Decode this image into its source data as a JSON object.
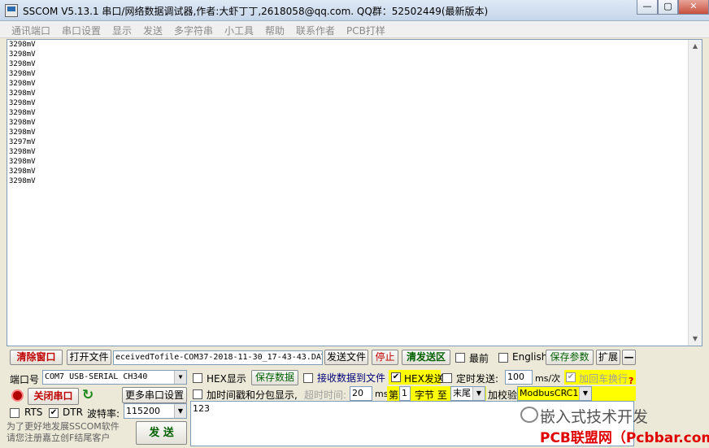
{
  "window": {
    "title": "SSCOM V5.13.1 串口/网络数据调试器,作者:大虾丁丁,2618058@qq.com. QQ群：52502449(最新版本)",
    "minimize_glyph": "—",
    "restore_glyph": "▢",
    "close_glyph": "✕"
  },
  "menu": [
    "通讯端口",
    "串口设置",
    "显示",
    "发送",
    "多字符串",
    "小工具",
    "帮助",
    "联系作者",
    "PCB打样"
  ],
  "receive": {
    "lines": [
      "3298mV",
      "3298mV",
      "3298mV",
      "3298mV",
      "3298mV",
      "3298mV",
      "3298mV",
      "3298mV",
      "3298mV",
      "3298mV",
      "3297mV",
      "3298mV",
      "3298mV",
      "3298mV",
      "3298mV"
    ]
  },
  "toolbar": {
    "clear_window": "清除窗口",
    "open_file": "打开文件",
    "file_path": "eceivedTofile-COM37-2018-11-30_17-43-43.DAT",
    "send_file": "发送文件",
    "stop": "停止",
    "clear_send": "清发送区",
    "topmost": "最前",
    "english": "English",
    "save_params": "保存参数",
    "expand": "扩展",
    "collapse": "—"
  },
  "port": {
    "port_label": "端口号",
    "port_value": "COM7 USB-SERIAL CH340",
    "close_port": "关闭串口",
    "more_settings": "更多串口设置",
    "rts": "RTS",
    "dtr": "DTR",
    "baud_label": "波特率:",
    "baud_value": "115200"
  },
  "options": {
    "hex_display": "HEX显示",
    "save_data": "保存数据",
    "recv_to_file": "接收数据到文件",
    "hex_send": "HEX发送",
    "timed_send": "定时发送:",
    "interval": "100",
    "interval_unit": "ms/次",
    "add_crlf": "加回车换行",
    "help_mark": "?",
    "timestamp": "加时间戳和分包显示,",
    "timeout_label": "超时时间:",
    "timeout_value": "20",
    "timeout_unit": "ms",
    "nth_label": "第",
    "nth_value": "1",
    "byte_label": "字节 至",
    "end_value": "末尾",
    "checksum_label": "加校验",
    "checksum_value": "ModbusCRC16"
  },
  "send": {
    "button": "发 送",
    "text": "123"
  },
  "notice": {
    "line1": "为了更好地发展SSCOM软件",
    "line2": "请您注册嘉立创F结尾客户"
  },
  "watermark": {
    "text": "嵌入式技术开发",
    "banner": "PCB联盟网（Pcbbar.com）"
  },
  "colors": {
    "accent_red": "#c00000",
    "accent_green": "#006000",
    "highlight_yellow": "#ffff00"
  }
}
